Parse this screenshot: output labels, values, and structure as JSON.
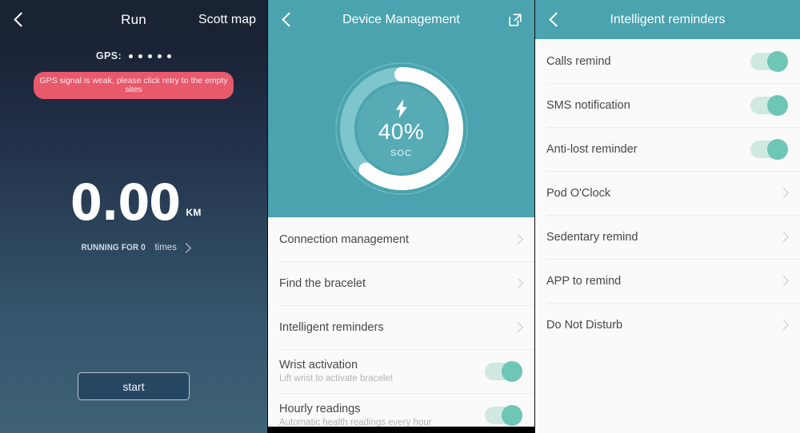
{
  "run": {
    "header": {
      "back_icon": "back-chevron-icon",
      "title": "Run",
      "right_link": "Scott map"
    },
    "gps": {
      "label": "GPS:",
      "dot_count": 5,
      "warning": "GPS signal is weak, please click retry to the empty sites",
      "warning_color": "#e8596c"
    },
    "distance": {
      "value": "0.00",
      "unit": "KM"
    },
    "run_count": {
      "prefix": "RUNNING FOR 0",
      "suffix": "times",
      "chevron_icon": "chevron-right-icon"
    },
    "start_label": "start"
  },
  "device": {
    "header": {
      "back_icon": "back-chevron-icon",
      "title": "Device Management",
      "action_icon": "external-link-icon",
      "bg_color": "#4aa3ae"
    },
    "battery": {
      "percent_label": "40%",
      "percent_value": 40,
      "unit_label": "SOC",
      "bolt_icon": "lightning-bolt-icon",
      "arc_color": "#ffffff",
      "track_color": "#7fc0c9"
    },
    "rows": [
      {
        "label": "Connection management",
        "sub": null,
        "control": "chevron",
        "icon": "chevron-right-icon"
      },
      {
        "label": "Find the bracelet",
        "sub": null,
        "control": "chevron",
        "icon": "chevron-right-icon"
      },
      {
        "label": "Intelligent reminders",
        "sub": null,
        "control": "chevron",
        "icon": "chevron-right-icon"
      },
      {
        "label": "Wrist activation",
        "sub": "Lift wrist to activate bracelet",
        "control": "toggle",
        "state": "on"
      },
      {
        "label": "Hourly readings",
        "sub": "Automatic health readings every hour",
        "control": "toggle",
        "state": "on"
      }
    ]
  },
  "reminders": {
    "header": {
      "back_icon": "back-chevron-icon",
      "title": "Intelligent reminders",
      "bg_color": "#4aa3ae"
    },
    "rows": [
      {
        "label": "Calls remind",
        "control": "toggle",
        "state": "on"
      },
      {
        "label": "SMS notification",
        "control": "toggle",
        "state": "on"
      },
      {
        "label": "Anti-lost reminder",
        "control": "toggle",
        "state": "on"
      },
      {
        "label": "Pod O'Clock",
        "control": "chevron",
        "icon": "chevron-right-icon"
      },
      {
        "label": "Sedentary remind",
        "control": "chevron",
        "icon": "chevron-right-icon"
      },
      {
        "label": "APP to remind",
        "control": "chevron",
        "icon": "chevron-right-icon"
      },
      {
        "label": "Do Not Disturb",
        "control": "chevron",
        "icon": "chevron-right-icon"
      }
    ]
  }
}
